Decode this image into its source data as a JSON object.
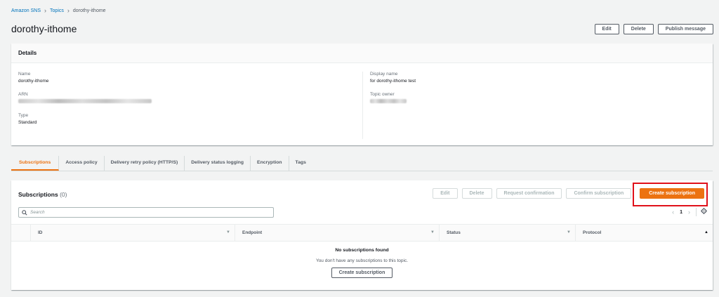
{
  "breadcrumb": {
    "root": "Amazon SNS",
    "parent": "Topics",
    "current": "dorothy-ithome"
  },
  "page": {
    "title": "dorothy-ithome"
  },
  "header_actions": {
    "edit": "Edit",
    "delete": "Delete",
    "publish": "Publish message"
  },
  "details": {
    "heading": "Details",
    "name_label": "Name",
    "name_value": "dorothy-ithome",
    "arn_label": "ARN",
    "type_label": "Type",
    "type_value": "Standard",
    "display_name_label": "Display name",
    "display_name_value": "for dorothy-ithome test",
    "topic_owner_label": "Topic owner"
  },
  "tabs": [
    "Subscriptions",
    "Access policy",
    "Delivery retry policy (HTTP/S)",
    "Delivery status logging",
    "Encryption",
    "Tags"
  ],
  "subscriptions": {
    "title": "Subscriptions",
    "count": "(0)",
    "actions": {
      "edit": "Edit",
      "delete": "Delete",
      "request_confirmation": "Request confirmation",
      "confirm_subscription": "Confirm subscription",
      "create_subscription": "Create subscription"
    },
    "search_placeholder": "Search",
    "page_number": "1",
    "columns": [
      "ID",
      "Endpoint",
      "Status",
      "Protocol"
    ],
    "empty_title": "No subscriptions found",
    "empty_text": "You don't have any subscriptions to this topic.",
    "empty_button": "Create subscription"
  },
  "colors": {
    "accent": "#ec7211",
    "link": "#0073bb",
    "highlight": "#e0101a"
  }
}
